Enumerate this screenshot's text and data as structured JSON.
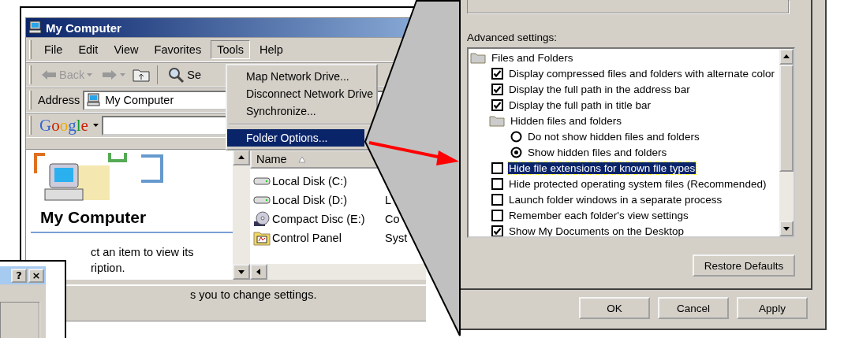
{
  "explorer": {
    "title": "My Computer",
    "menu": [
      {
        "label": "File",
        "selected": false
      },
      {
        "label": "Edit",
        "selected": false
      },
      {
        "label": "View",
        "selected": false
      },
      {
        "label": "Favorites",
        "selected": false
      },
      {
        "label": "Tools",
        "selected": true
      },
      {
        "label": "Help",
        "selected": false
      }
    ],
    "toolbar": {
      "back": "Back",
      "search": "Se"
    },
    "address": {
      "label": "Address",
      "value": "My Computer"
    },
    "google": {
      "logo": "Google"
    },
    "tools_menu": [
      {
        "kind": "item",
        "label": "Map Network Drive...",
        "selected": false
      },
      {
        "kind": "item",
        "label": "Disconnect Network Drive",
        "selected": false
      },
      {
        "kind": "item",
        "label": "Synchronize...",
        "selected": false
      },
      {
        "kind": "separator"
      },
      {
        "kind": "item",
        "label": "Folder Options...",
        "selected": true
      }
    ],
    "left_pane": {
      "heading": "My Computer",
      "description": [
        "ct an item to view its",
        "ription."
      ]
    },
    "list": {
      "columns": [
        "Name"
      ],
      "rows": [
        {
          "kind": "drive",
          "name": "Local Disk (C:)"
        },
        {
          "kind": "drive",
          "name": "Local Disk (D:)",
          "column_2": "L"
        },
        {
          "kind": "cd",
          "name": "Compact Disc (E:)",
          "column_2": "Co"
        },
        {
          "kind": "control_panel",
          "name": "Control Panel",
          "column_2": "Syst"
        }
      ]
    },
    "status": "s you to change settings."
  },
  "dialog_fragment": {
    "buttons": [
      "?",
      "×"
    ]
  },
  "folder_options": {
    "label": "Advanced settings:",
    "tree": [
      {
        "kind": "folder",
        "label": "Files and Folders",
        "selected": false,
        "children": [
          {
            "kind": "checkbox",
            "label": "Display compressed files and folders with alternate color",
            "checked": true,
            "selected": false
          },
          {
            "kind": "checkbox",
            "label": "Display the full path in the address bar",
            "checked": true,
            "selected": false
          },
          {
            "kind": "checkbox",
            "label": "Display the full path in title bar",
            "checked": true,
            "selected": false
          },
          {
            "kind": "folder",
            "label": "Hidden files and folders",
            "selected": false,
            "children": [
              {
                "kind": "radio",
                "label": "Do not show hidden files and folders",
                "checked": false,
                "selected": false
              },
              {
                "kind": "radio",
                "label": "Show hidden files and folders",
                "checked": true,
                "selected": false
              }
            ]
          },
          {
            "kind": "checkbox",
            "label": "Hide file extensions for known file types",
            "checked": false,
            "selected": true
          },
          {
            "kind": "checkbox",
            "label": "Hide protected operating system files (Recommended)",
            "checked": false,
            "selected": false
          },
          {
            "kind": "checkbox",
            "label": "Launch folder windows in a separate process",
            "checked": false,
            "selected": false
          },
          {
            "kind": "checkbox",
            "label": "Remember each folder's view settings",
            "checked": false,
            "selected": false
          },
          {
            "kind": "checkbox",
            "label": "Show My Documents on the Desktop",
            "checked": true,
            "selected": false
          }
        ]
      }
    ],
    "restore_button": "Restore Defaults",
    "buttons": [
      "OK",
      "Cancel",
      "Apply"
    ]
  }
}
